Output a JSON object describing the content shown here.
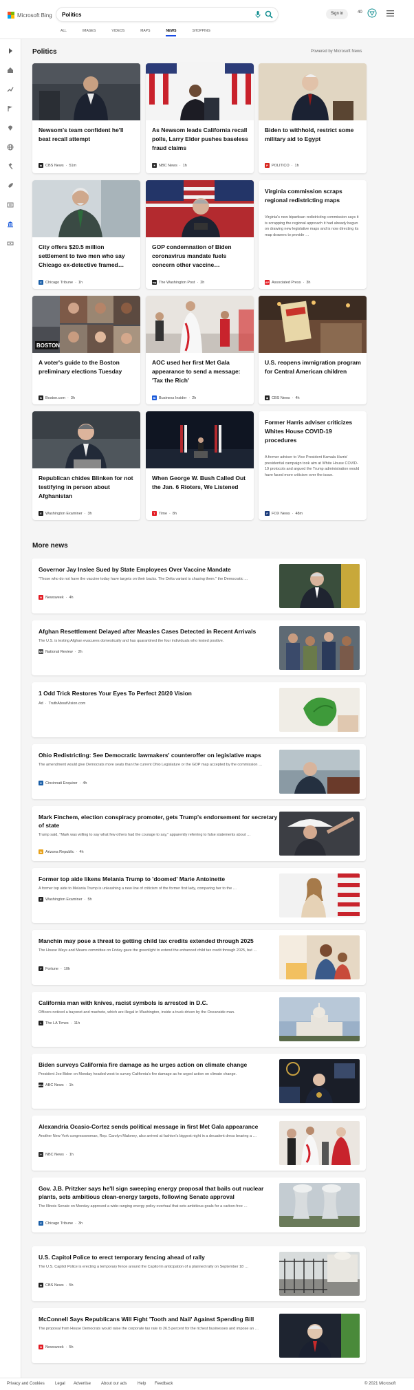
{
  "brand": {
    "name": "Microsoft Bing"
  },
  "search": {
    "query": "Politics"
  },
  "header": {
    "signin_label": "Sign in",
    "points": "40"
  },
  "tabs": [
    {
      "label": "ALL"
    },
    {
      "label": "IMAGES"
    },
    {
      "label": "VIDEOS"
    },
    {
      "label": "MAPS"
    },
    {
      "label": "NEWS",
      "active": true
    },
    {
      "label": "SHOPPING"
    }
  ],
  "politics": {
    "title": "Politics",
    "powered_by": "Powered by Microsoft News",
    "cards": [
      {
        "title": "Newsom's team confident he'll beat recall attempt",
        "source": "CBS News",
        "time": "51m",
        "icon": "cbs-icon",
        "icon_color": "#222222"
      },
      {
        "title": "As Newsom leads California recall polls, Larry Elder pushes baseless fraud claims",
        "source": "NBC News",
        "time": "1h",
        "icon": "nbc-icon",
        "icon_color": "#333333"
      },
      {
        "title": "Biden to withhold, restrict some military aid to Egypt",
        "source": "POLITICO",
        "time": "1h",
        "icon": "politico-icon",
        "icon_color": "#d7261e"
      },
      {
        "title": "City offers $20.5 million settlement to two men who say Chicago ex-detective framed…",
        "source": "Chicago Tribune",
        "time": "1h",
        "icon": "chicago-tribune-icon",
        "icon_color": "#1b5fa8"
      },
      {
        "title": "GOP condemnation of Biden coronavirus mandate fuels concern other vaccine…",
        "source": "The Washington Post",
        "time": "2h",
        "icon": "washington-post-icon",
        "icon_color": "#222222"
      },
      {
        "title": "Virginia commission scraps regional redistricting maps",
        "description": "Virginia's new bipartisan redistricting commission says it is scrapping the regional approach it had already begun on drawing new legislative maps and is now directing its map drawers to provide …",
        "source": "Associated Press",
        "time": "3h",
        "icon": "ap-icon",
        "icon_color": "#e31b23"
      },
      {
        "title": "A voter's guide to the Boston preliminary elections Tuesday",
        "source": "Boston.com",
        "time": "3h",
        "icon": "boston-icon",
        "icon_color": "#222222"
      },
      {
        "title": "AOC used her first Met Gala appearance to send a message: 'Tax the Rich'",
        "source": "Business Insider",
        "time": "2h",
        "icon": "business-insider-icon",
        "icon_color": "#1a5adb"
      },
      {
        "title": "U.S. reopens immigration program for Central American children",
        "source": "CBS News",
        "time": "4h",
        "icon": "cbs-icon",
        "icon_color": "#222222"
      },
      {
        "title": "Republican chides Blinken for not testifying in person about Afghanistan",
        "source": "Washington Examiner",
        "time": "3h",
        "icon": "washington-examiner-icon",
        "icon_color": "#222222"
      },
      {
        "title": "When George W. Bush Called Out the Jan. 6 Rioters, We Listened",
        "source": "Time",
        "time": "8h",
        "icon": "time-icon",
        "icon_color": "#e41e26"
      },
      {
        "title": "Former Harris adviser criticizes Whites House COVID-19 procedures",
        "description": "A former adviser to Vice President Kamala Harris' presidential campaign took aim at White House COVID-19 protocols and argued the Trump administration would have faced more criticism over the issue.",
        "source": "FOX News",
        "time": "48m",
        "icon": "fox-news-icon",
        "icon_color": "#1a3a7a"
      }
    ]
  },
  "more_news": {
    "title": "More news",
    "items": [
      {
        "title": "Governor Jay Inslee Sued by State Employees Over Vaccine Mandate",
        "description": "\"Those who do not have the vaccine today have targets on their backs. The Delta variant is chasing them.\" the Democratic …",
        "source": "Newsweek",
        "time": "4h",
        "icon": "newsweek-icon",
        "icon_color": "#e31b23"
      },
      {
        "title": "Afghan Resettlement Delayed after Measles Cases Detected in Recent Arrivals",
        "description": "The U.S. is testing Afghan evacuees domestically and has quarantined the four individuals who tested positive.",
        "source": "National Review",
        "time": "2h",
        "icon": "national-review-icon",
        "icon_color": "#444444"
      },
      {
        "title": "1 Odd Trick Restores Your Eyes To Perfect 20/20 Vision",
        "description": "",
        "source": "TruthAboutVision.com",
        "time": "",
        "ad_label": "Ad",
        "icon": "",
        "icon_color": ""
      },
      {
        "title": "Ohio Redistricting: See Democratic lawmakers' counteroffer on legislative maps",
        "description": "The amendment would give Democrats more seats than the current Ohio Legislature or the GOP map accepted by the commission …",
        "source": "Cincinnati Enquirer",
        "time": "4h",
        "icon": "cincinnati-enquirer-icon",
        "icon_color": "#1b5fa8"
      },
      {
        "title": "Mark Finchem, election conspiracy promoter, gets Trump's endorsement for secretary of state",
        "description": "Trump said, \"Mark was willing to say what few others had the courage to say,\" apparently referring to false statements about …",
        "source": "Arizona Republic",
        "time": "4h",
        "icon": "arizona-republic-icon",
        "icon_color": "#e8a21b"
      },
      {
        "title": "Former top aide likens Melania Trump to 'doomed' Marie Antoinette",
        "description": "A former top aide to Melania Trump is unleashing a new line of criticism of the former first lady, comparing her to the …",
        "source": "Washington Examiner",
        "time": "5h",
        "icon": "washington-examiner-icon",
        "icon_color": "#222222"
      },
      {
        "title": "Manchin may pose a threat to getting child tax credits extended through 2025",
        "description": "The House Ways and Means committee on Friday gave the greenlight to extend the enhanced child tax credit through 2025, but …",
        "source": "Fortune",
        "time": "10h",
        "icon": "fortune-icon",
        "icon_color": "#222222"
      },
      {
        "title": "California man with knives, racist symbols is arrested in D.C.",
        "description": "Officers noticed a bayonet and machete, which are illegal in Washington, inside a truck driven by the Oceanside man.",
        "source": "The LA Times",
        "time": "11h",
        "icon": "la-times-icon",
        "icon_color": "#222222"
      },
      {
        "title": "Biden surveys California fire damage as he urges action on climate change",
        "description": "President Joe Biden on Monday headed west to survey California's fire damage as he urged action on climate change.",
        "source": "ABC News",
        "time": "1h",
        "icon": "abc-news-icon",
        "icon_color": "#222222"
      },
      {
        "title": "Alexandria Ocasio-Cortez sends political message in first Met Gala appearance",
        "description": "Another New York congresswoman, Rep. Carolyn Maloney, also arrived at fashion's biggest night in a decadent dress bearing a …",
        "source": "NBC News",
        "time": "1h",
        "icon": "nbc-icon",
        "icon_color": "#333333"
      },
      {
        "title": "Gov. J.B. Pritzker says he'll sign sweeping energy proposal that bails out nuclear plants, sets ambitious clean-energy targets, following Senate approval",
        "description": "The Illinois Senate on Monday approved a wide-ranging energy policy overhaul that sets ambitious goals for a carbon-free …",
        "source": "Chicago Tribune",
        "time": "3h",
        "icon": "chicago-tribune-icon",
        "icon_color": "#1b5fa8"
      },
      {
        "title": "U.S. Capitol Police to erect temporary fencing ahead of rally",
        "description": "The U.S. Capitol Police is erecting a temporary fence around the Capitol in anticipation of a planned rally on September 18 …",
        "source": "CBS News",
        "time": "5h",
        "icon": "cbs-icon",
        "icon_color": "#222222"
      },
      {
        "title": "McConnell Says Republicans Will Fight 'Tooth and Nail' Against Spending Bill",
        "description": "The proposal from House Democrats would raise the corporate tax rate to 26.5 percent for the richest businesses and impose an …",
        "source": "Newsweek",
        "time": "5h",
        "icon": "newsweek-icon",
        "icon_color": "#e31b23"
      }
    ]
  },
  "footer": {
    "links": [
      "Privacy and Cookies",
      "Legal",
      "Advertise",
      "About our ads",
      "Help",
      "Feedback"
    ],
    "copyright": "© 2021 Microsoft"
  },
  "colors": {
    "accent": "#174ae4",
    "bing_teal": "#0e8d8f"
  }
}
